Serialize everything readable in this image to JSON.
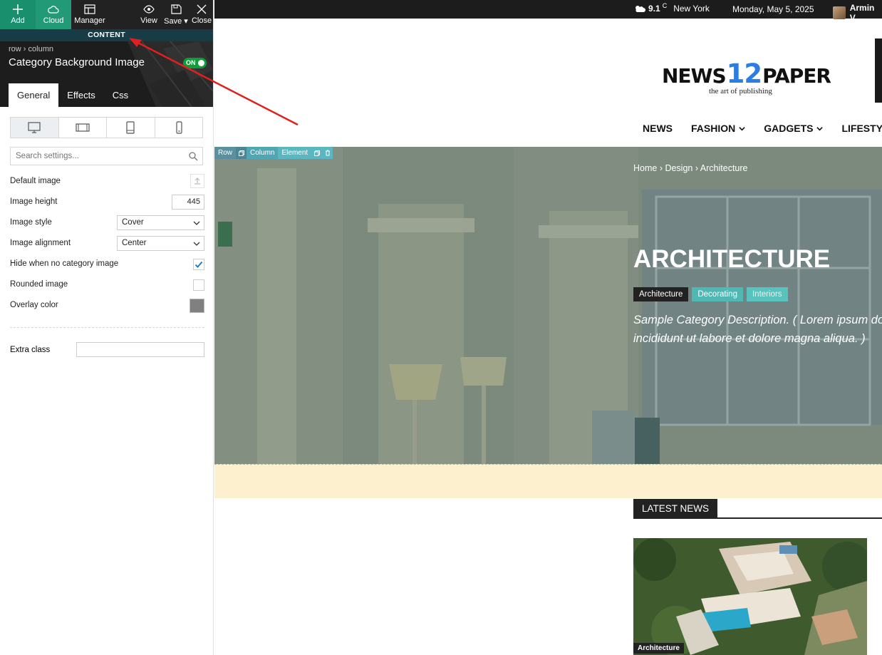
{
  "toolbar": {
    "add": "Add",
    "cloud": "Cloud",
    "manager": "Manager",
    "view": "View",
    "save": "Save",
    "close": "Close"
  },
  "content_label": "CONTENT",
  "panel": {
    "breadcrumb_row": "row",
    "breadcrumb_column": "column",
    "title": "Category Background Image",
    "toggle": "ON",
    "tabs": [
      "General",
      "Effects",
      "Css"
    ],
    "search_placeholder": "Search settings...",
    "fields": {
      "default_image": "Default image",
      "image_height_label": "Image height",
      "image_height_value": "445",
      "image_style_label": "Image style",
      "image_style_value": "Cover",
      "image_alignment_label": "Image alignment",
      "image_alignment_value": "Center",
      "hide_label": "Hide when no category image",
      "hide_checked": true,
      "rounded_label": "Rounded image",
      "rounded_checked": false,
      "overlay_label": "Overlay color",
      "overlay_color": "#808080",
      "extra_class_label": "Extra class"
    }
  },
  "site": {
    "weather_temp": "9.1",
    "weather_unit": "C",
    "weather_city": "New York",
    "date": "Monday, May 5, 2025",
    "user": "Armin V",
    "logo_left": "NEWS",
    "logo_num": "12",
    "logo_right": "PAPER",
    "tagline": "the art of publishing",
    "nav": [
      "NEWS",
      "FASHION",
      "GADGETS",
      "LIFESTY"
    ],
    "edit_bar": {
      "row": "Row",
      "column": "Column",
      "element": "Element"
    },
    "breadcrumb": [
      "Home",
      "Design",
      "Architecture"
    ],
    "category_title": "ARCHITECTURE",
    "chips": [
      "Architecture",
      "Decorating",
      "Interiors"
    ],
    "description_line1": "Sample Category Description. ( Lorem ipsum do",
    "description_line2": "incididunt ut labore et dolore magna aliqua. )",
    "latest_news": "LATEST NEWS",
    "thumb_tag": "Architecture"
  }
}
